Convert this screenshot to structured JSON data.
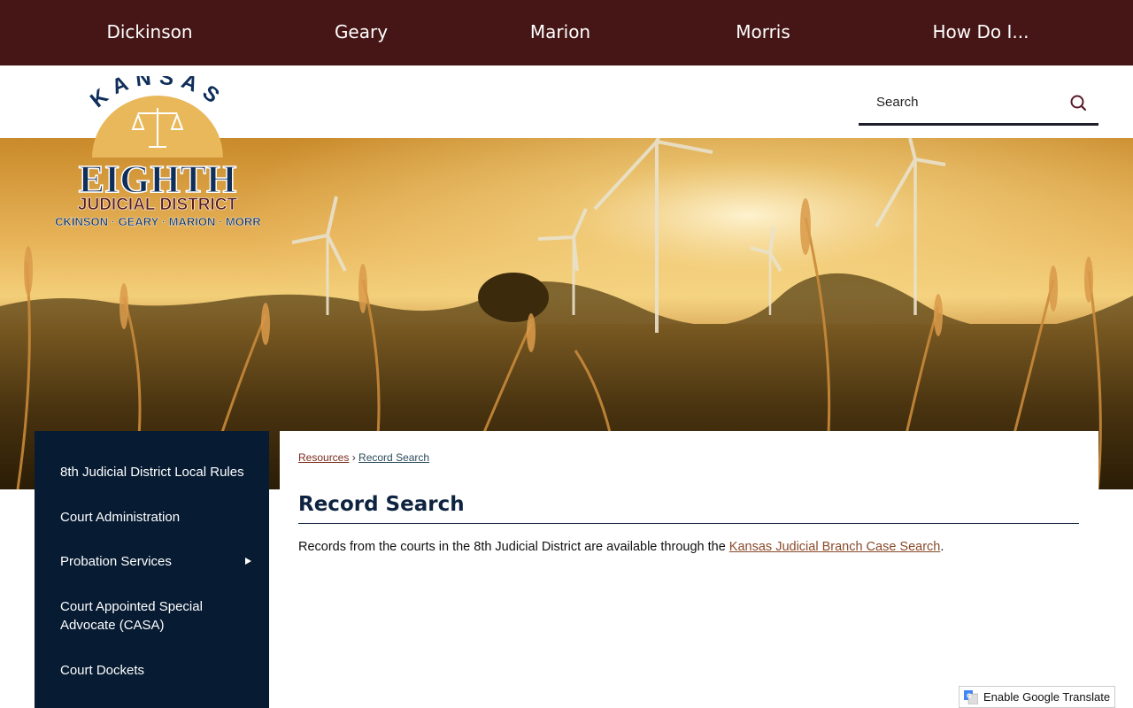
{
  "topnav": {
    "items": [
      "Dickinson",
      "Geary",
      "Marion",
      "Morris",
      "How Do I..."
    ]
  },
  "logo": {
    "top_text": "KANSAS",
    "main_text": "EIGHTH",
    "sub_text": "JUDICIAL DISTRICT",
    "counties_text": "DICKINSON · GEARY · MARION · MORRIS"
  },
  "search": {
    "placeholder": "Search",
    "icon": "search-icon"
  },
  "sidebar": {
    "items": [
      {
        "label": "8th Judicial District Local Rules",
        "has_submenu": false
      },
      {
        "label": "Court Administration",
        "has_submenu": false
      },
      {
        "label": "Probation Services",
        "has_submenu": true
      },
      {
        "label": "Court Appointed Special Advocate (CASA)",
        "has_submenu": false
      },
      {
        "label": "Court Dockets",
        "has_submenu": false
      }
    ]
  },
  "breadcrumb": {
    "parent": "Resources",
    "separator": "›",
    "current": "Record Search"
  },
  "page": {
    "title": "Record Search",
    "body_prefix": "Records from the courts in the 8th Judicial District are available through the ",
    "body_link": "Kansas Judicial Branch Case Search",
    "body_suffix": "."
  },
  "translate": {
    "label": "Enable Google Translate"
  },
  "colors": {
    "topnav_bg": "#461616",
    "sidebar_bg": "#071b33",
    "title_color": "#0d2340",
    "link_color": "#8a4a2a"
  }
}
